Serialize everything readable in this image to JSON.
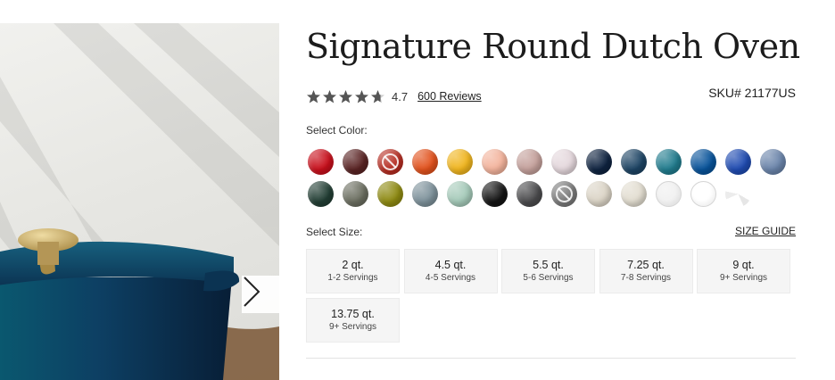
{
  "product": {
    "title": "Signature Round Dutch Oven",
    "rating_value": "4.7",
    "rating_stars": 4.7,
    "reviews_label": "600 Reviews",
    "sku": "SKU# 21177US"
  },
  "color_section": {
    "label": "Select Color:",
    "swatches_row1": [
      {
        "color": "#c8101c",
        "available": true
      },
      {
        "color": "#5a2424",
        "available": true
      },
      {
        "color": "#b62d22",
        "available": false
      },
      {
        "color": "#e2521d",
        "available": true
      },
      {
        "color": "#f0b51e",
        "available": true
      },
      {
        "color": "#f3b39c",
        "available": true
      },
      {
        "color": "#c4a09b",
        "available": true
      },
      {
        "color": "#e4d7dc",
        "available": true
      },
      {
        "color": "#0f2340",
        "available": true
      },
      {
        "color": "#1d4464",
        "available": true
      },
      {
        "color": "#217c8e",
        "available": true
      },
      {
        "color": "#08539a",
        "available": true
      },
      {
        "color": "#1f4bb1",
        "available": true
      },
      {
        "color": "#6a84aa",
        "available": true
      }
    ],
    "swatches_row2": [
      {
        "color": "#223e34",
        "available": true
      },
      {
        "color": "#6b6e60",
        "available": true
      },
      {
        "color": "#8e8a12",
        "available": true
      },
      {
        "color": "#7d919a",
        "available": true
      },
      {
        "color": "#a5cab9",
        "available": true
      },
      {
        "color": "#141414",
        "available": true
      },
      {
        "color": "#4b4b4d",
        "available": true
      },
      {
        "color": "#7a7a7a",
        "available": false
      },
      {
        "color": "#dbd4c6",
        "available": true
      },
      {
        "color": "#e2ddd0",
        "available": true
      },
      {
        "color": "#f1f1f1",
        "available": true
      },
      {
        "color": "#ffffff",
        "available": true
      },
      {
        "color": "#ffffff",
        "available": true
      }
    ]
  },
  "size_section": {
    "label": "Select Size:",
    "guide_label": "SIZE GUIDE",
    "sizes": [
      {
        "quarts": "2 qt.",
        "servings": "1-2 Servings"
      },
      {
        "quarts": "4.5 qt.",
        "servings": "4-5 Servings"
      },
      {
        "quarts": "5.5 qt.",
        "servings": "5-6 Servings"
      },
      {
        "quarts": "7.25 qt.",
        "servings": "7-8 Servings"
      },
      {
        "quarts": "9 qt.",
        "servings": "9+ Servings"
      },
      {
        "quarts": "13.75 qt.",
        "servings": "9+ Servings"
      }
    ]
  },
  "gallery": {
    "next_icon": "chevron-right-icon",
    "pot_color": "#0d3f63",
    "knob_color": "#c6a862"
  }
}
